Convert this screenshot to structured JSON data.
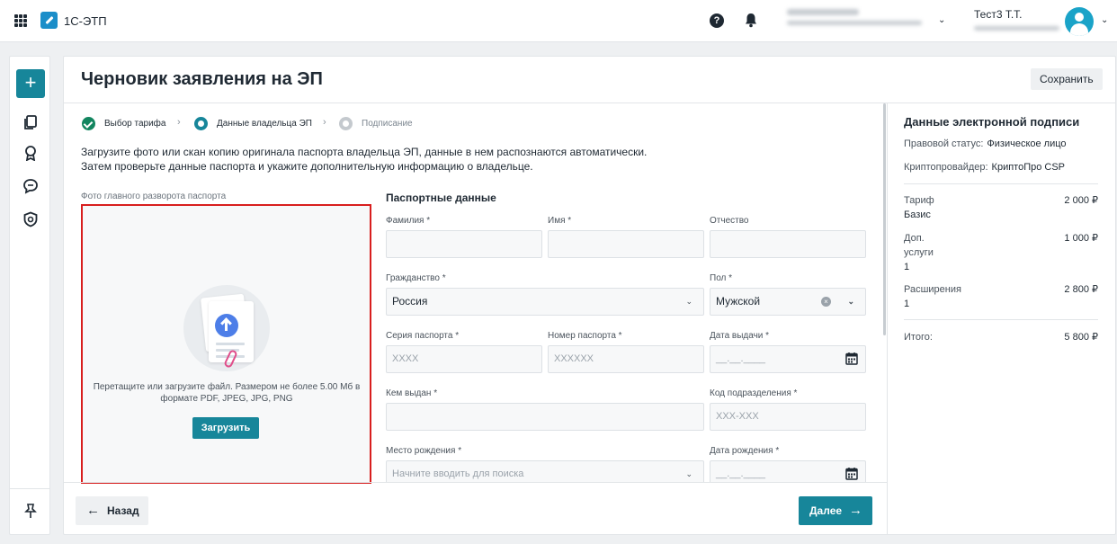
{
  "app": {
    "title": "1С-ЭТП"
  },
  "user": {
    "name": "Тест3 Т.Т."
  },
  "page": {
    "title": "Черновик заявления на ЭП",
    "save_label": "Сохранить"
  },
  "steps": [
    {
      "label": "Выбор тарифа",
      "state": "done"
    },
    {
      "label": "Данные владельца ЭП",
      "state": "active"
    },
    {
      "label": "Подписание",
      "state": "pending"
    }
  ],
  "intro": {
    "line1": "Загрузите фото или скан копию оригинала паспорта владельца ЭП, данные в нем распознаются автоматически.",
    "line2": "Затем проверьте данные паспорта и укажите дополнительную информацию о владельце."
  },
  "upload": {
    "label": "Фото главного разворота паспорта",
    "hint": "Перетащите или загрузите файл. Размером не более 5.00 Мб в формате PDF, JPEG, JPG, PNG",
    "button": "Загрузить"
  },
  "form": {
    "section_title": "Паспортные данные",
    "lastname_label": "Фамилия *",
    "firstname_label": "Имя *",
    "middlename_label": "Отчество",
    "citizenship_label": "Гражданство *",
    "citizenship_value": "Россия",
    "gender_label": "Пол *",
    "gender_value": "Мужской",
    "series_label": "Серия паспорта *",
    "series_placeholder": "XXXX",
    "number_label": "Номер паспорта *",
    "number_placeholder": "XXXXXX",
    "issue_date_label": "Дата выдачи *",
    "issue_date_placeholder": "__.__.____",
    "issued_by_label": "Кем выдан *",
    "dept_code_label": "Код подразделения *",
    "dept_code_placeholder": "XXX-XXX",
    "birthplace_label": "Место рождения *",
    "birthplace_placeholder": "Начните вводить для поиска",
    "birthdate_label": "Дата рождения *",
    "birthdate_placeholder": "__.__.____"
  },
  "nav": {
    "back_label": "Назад",
    "next_label": "Далее"
  },
  "summary": {
    "title": "Данные электронной подписи",
    "legal_status_label": "Правовой статус:",
    "legal_status_value": "Физическое лицо",
    "crypto_label": "Криптопровайдер:",
    "crypto_value": "КриптоПро CSP",
    "tariff_label": "Тариф",
    "tariff_name": "Базис",
    "tariff_price": "2 000 ₽",
    "extra_label_1": "Доп.",
    "extra_label_2": "услуги",
    "extra_count": "1",
    "extra_price": "1 000 ₽",
    "ext_label": "Расширения",
    "ext_count": "1",
    "ext_price": "2 800 ₽",
    "total_label": "Итого:",
    "total_price": "5 800 ₽"
  },
  "colors": {
    "accent": "#17869a",
    "done": "#12855f",
    "highlight": "#d81e1e"
  }
}
